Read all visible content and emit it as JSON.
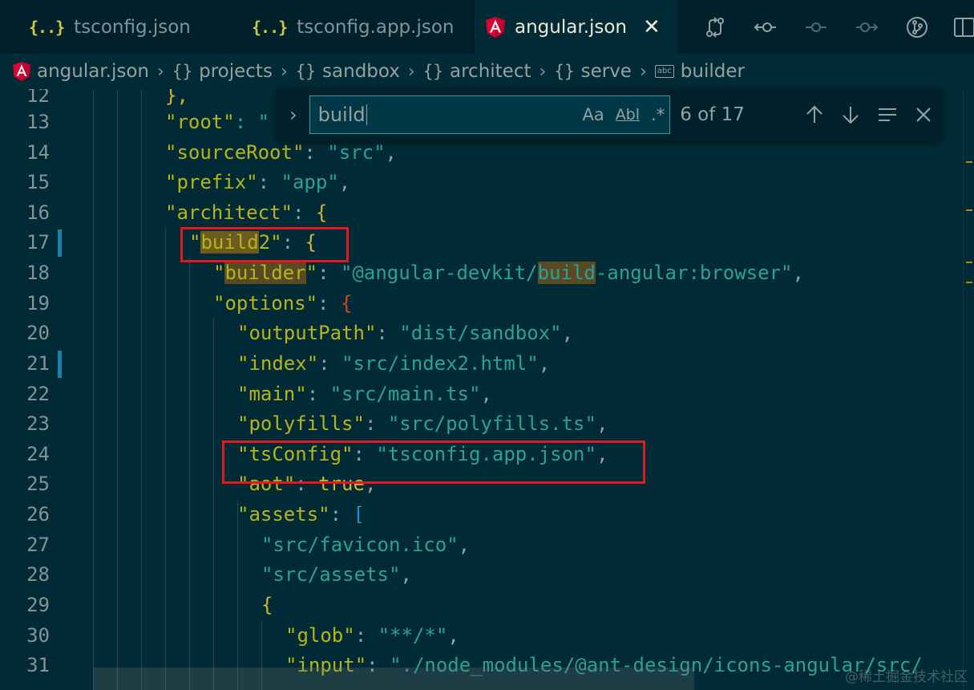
{
  "tabs": [
    {
      "label": "tsconfig.json",
      "icon": "json-icon"
    },
    {
      "label": "tsconfig.app.json",
      "icon": "json-icon"
    },
    {
      "label": "angular.json",
      "icon": "angular-icon",
      "active": true,
      "close": "✕"
    }
  ],
  "breadcrumb": {
    "file": "angular.json",
    "items": [
      "projects",
      "sandbox",
      "architect",
      "serve",
      "builder"
    ],
    "braces": "{}",
    "string_icon": "abc"
  },
  "find": {
    "toggle": "›",
    "value": "build",
    "match_case": "Aa",
    "whole_word": "Abl",
    "regex": ".*",
    "count": "6 of 17"
  },
  "gutter": [
    "12",
    "13",
    "14",
    "15",
    "16",
    "17",
    "18",
    "19",
    "20",
    "21",
    "22",
    "23",
    "24",
    "25",
    "26",
    "27",
    "28",
    "29",
    "30",
    "31"
  ],
  "code": {
    "l12": "},",
    "l13_key": "\"root\"",
    "l13_rest": ": \"",
    "l14_key": "\"sourceRoot\"",
    "l14_val": "\"src\"",
    "l15_key": "\"prefix\"",
    "l15_val": "\"app\"",
    "l16_key": "\"architect\"",
    "l16_brace": "{",
    "l17_q": "\"",
    "l17_match": "build",
    "l17_tail": "2\"",
    "l17_brace": "{",
    "l18_q": "\"",
    "l18_match": "builder",
    "l18_q2": "\"",
    "l18_val1": "\"@angular-devkit/",
    "l18_valmatch": "build",
    "l18_val2": "-angular:browser\"",
    "l19_key": "\"options\"",
    "l19_brace": "{",
    "l20_key": "\"outputPath\"",
    "l20_val": "\"dist/sandbox\"",
    "l21_key": "\"index\"",
    "l21_val": "\"src/index2.html\"",
    "l22_key": "\"main\"",
    "l22_val": "\"src/main.ts\"",
    "l23_key": "\"polyfills\"",
    "l23_val": "\"src/polyfills.ts\"",
    "l24_key": "\"tsConfig\"",
    "l24_val": "\"tsconfig.app.json\"",
    "l25_key": "\"aot\"",
    "l25_val": "true",
    "l26_key": "\"assets\"",
    "l26_brace": "[",
    "l27_val": "\"src/favicon.ico\"",
    "l28_val": "\"src/assets\"",
    "l29_brace": "{",
    "l30_key": "\"glob\"",
    "l30_val": "\"**/*\"",
    "l31_key": "\"input\"",
    "l31_val": "\"./node_modules/@ant-design/icons-angular/src/"
  },
  "colors": {
    "background": "#002b36",
    "key": "#b5b51a",
    "string": "#2aa198",
    "highlight": "#5a4a24",
    "annotation_box": "#e0191e"
  },
  "watermark": "@稀土掘金技术社区"
}
